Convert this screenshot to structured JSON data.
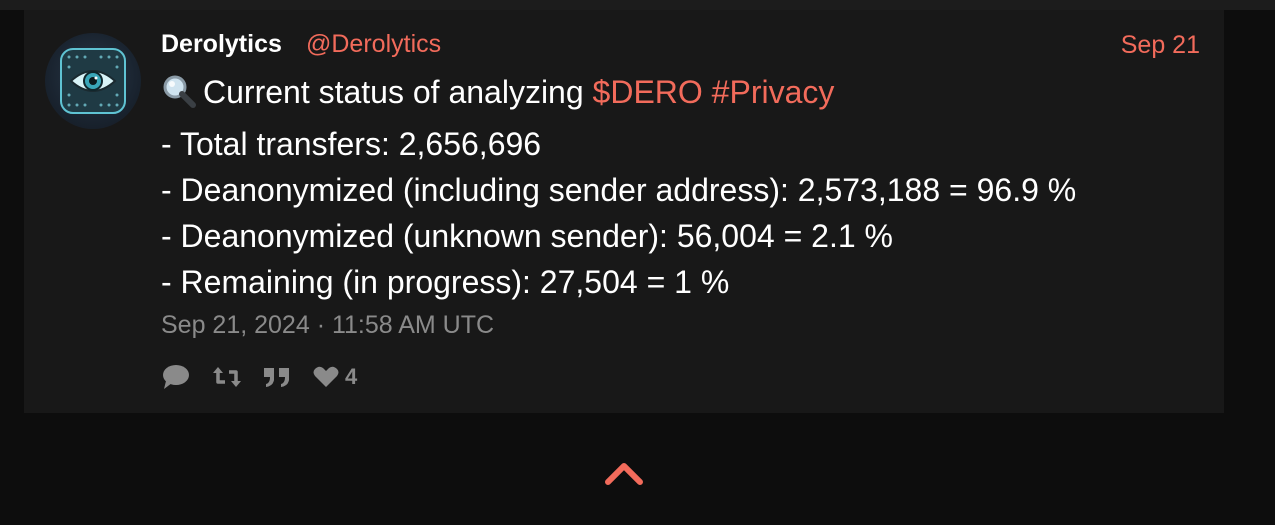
{
  "tweet": {
    "author_name": "Derolytics",
    "author_handle": "@Derolytics",
    "date_short": "Sep 21",
    "emoji": "🔍",
    "intro": "Current status of analyzing",
    "tag_dero": "$DERO",
    "tag_privacy": "#Privacy",
    "lines": [
      "- Total transfers: 2,656,696",
      "- Deanonymized (including sender address): 2,573,188 = 96.9 %",
      "- Deanonymized (unknown sender): 56,004 = 2.1 %",
      "- Remaining (in progress): 27,504 = 1 %"
    ],
    "timestamp": "Sep 21, 2024 · 11:58 AM UTC",
    "like_count": "4"
  },
  "icons": {
    "reply": "comment-icon",
    "retweet": "retweet-icon",
    "quote": "quote-icon",
    "like": "heart-icon",
    "scroll_top": "chevron-up-icon",
    "avatar": "eye-logo"
  },
  "colors": {
    "accent": "#f26b5b",
    "background": "#0d0d0d",
    "card": "#181818",
    "muted": "#8a8a8a",
    "text": "#ffffff"
  }
}
